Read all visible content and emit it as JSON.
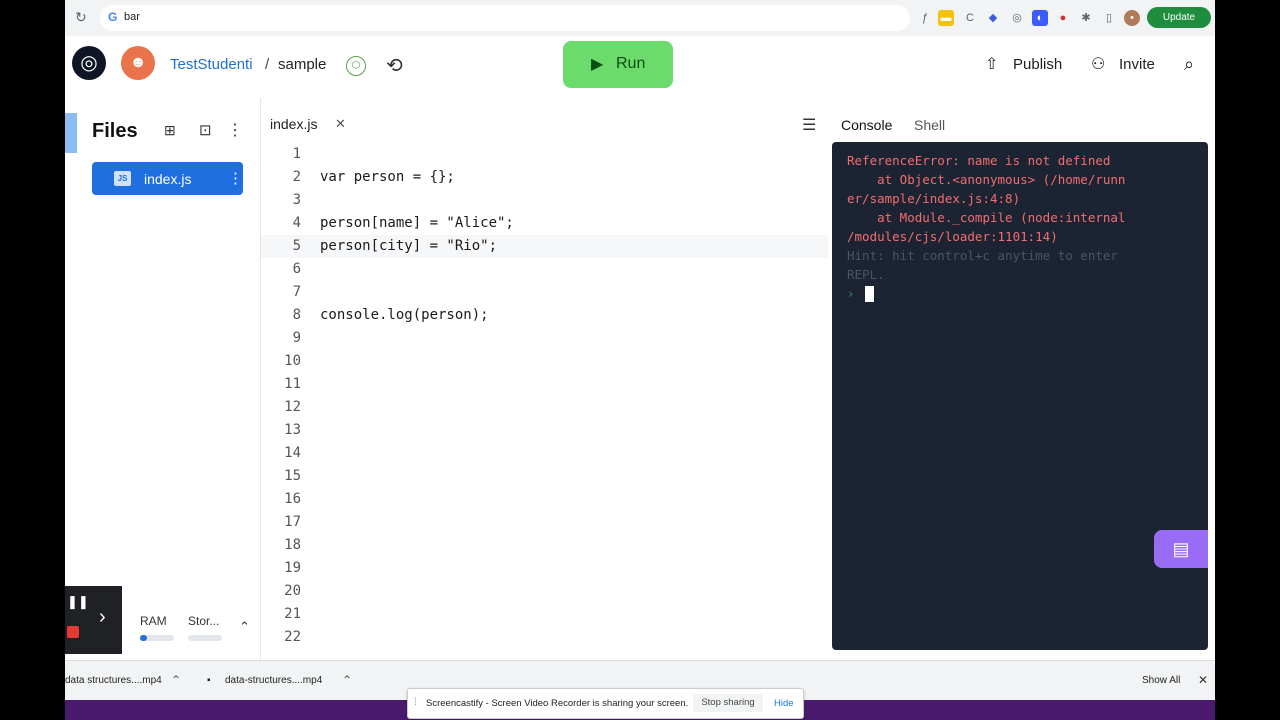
{
  "browser": {
    "omnibox_text": "bar",
    "update_label": "Update"
  },
  "header": {
    "user": "TestStudenti",
    "separator": "/",
    "repl_name": "sample",
    "run_label": "Run",
    "publish_label": "Publish",
    "invite_label": "Invite"
  },
  "files": {
    "title": "Files",
    "items": [
      {
        "name": "index.js",
        "icon_text": "JS"
      }
    ],
    "ram_label": "RAM",
    "storage_label": "Stor...",
    "ram_usage_fraction": 0.2
  },
  "editor": {
    "tab": "index.js",
    "active_line": 5,
    "lines": [
      {
        "n": "1",
        "code": ""
      },
      {
        "n": "2",
        "code": "var person = {};"
      },
      {
        "n": "3",
        "code": ""
      },
      {
        "n": "4",
        "code": "person[name] = \"Alice\";"
      },
      {
        "n": "5",
        "code": "person[city] = \"Rio\";"
      },
      {
        "n": "6",
        "code": ""
      },
      {
        "n": "7",
        "code": ""
      },
      {
        "n": "8",
        "code": "console.log(person);"
      },
      {
        "n": "9",
        "code": ""
      },
      {
        "n": "10",
        "code": ""
      },
      {
        "n": "11",
        "code": ""
      },
      {
        "n": "12",
        "code": ""
      },
      {
        "n": "13",
        "code": ""
      },
      {
        "n": "14",
        "code": ""
      },
      {
        "n": "15",
        "code": ""
      },
      {
        "n": "16",
        "code": ""
      },
      {
        "n": "17",
        "code": ""
      },
      {
        "n": "18",
        "code": ""
      },
      {
        "n": "19",
        "code": ""
      },
      {
        "n": "20",
        "code": ""
      },
      {
        "n": "21",
        "code": ""
      },
      {
        "n": "22",
        "code": ""
      }
    ]
  },
  "console": {
    "tabs": [
      "Console",
      "Shell"
    ],
    "error_lines": [
      "ReferenceError: name is not defined",
      "    at Object.<anonymous> (/home/runn",
      "er/sample/index.js:4:8)",
      "    at Module._compile (node:internal",
      "/modules/cjs/loader:1101:14)"
    ],
    "hint_lines": [
      "Hint: hit control+c anytime to enter",
      "REPL."
    ],
    "prompt": "›"
  },
  "downloads": {
    "items": [
      "data structures....mp4",
      "data-structures....mp4"
    ],
    "show_all": "Show All"
  },
  "share_bar": {
    "text": "Screencastify - Screen Video Recorder is sharing your screen.",
    "stop_label": "Stop sharing",
    "hide_label": "Hide"
  },
  "colors": {
    "run_green": "#6bdb6b",
    "accent_blue": "#1f6fe0",
    "console_bg": "#1c2333",
    "error_red": "#f26d6d",
    "chat_purple": "#9a6cf6"
  }
}
